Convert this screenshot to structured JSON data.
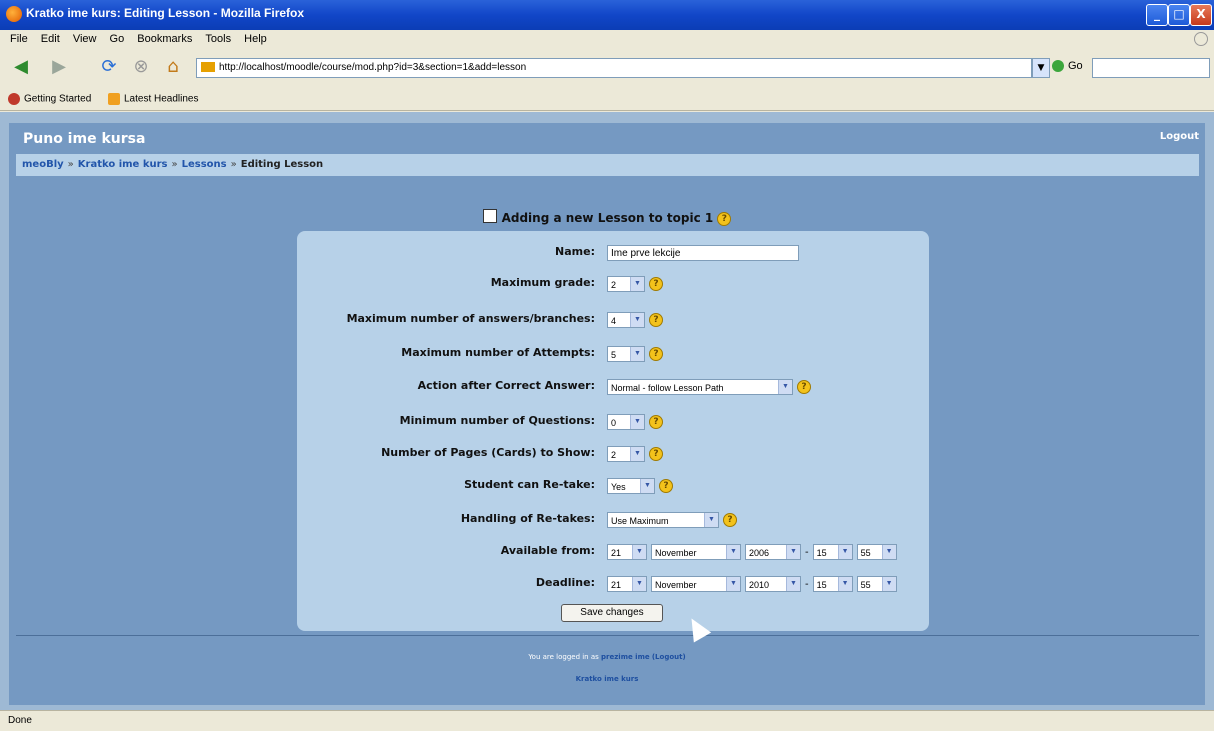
{
  "window": {
    "title": "Kratko ime kurs: Editing Lesson - Mozilla Firefox",
    "controls": {
      "minimize": "_",
      "maximize": "□",
      "close": "X"
    }
  },
  "menu": [
    "File",
    "Edit",
    "View",
    "Go",
    "Bookmarks",
    "Tools",
    "Help"
  ],
  "nav": {
    "url": "http://localhost/moodle/course/mod.php?id=3&section=1&add=lesson",
    "go_label": "Go"
  },
  "bookmarks": [
    {
      "label": "Getting Started",
      "color": "#c0392b"
    },
    {
      "label": "Latest Headlines",
      "color": "#f0a020"
    }
  ],
  "page": {
    "site_title": "Puno ime kursa",
    "logout": "Logout",
    "breadcrumb": [
      "meoBly",
      "Kratko ime kurs",
      "Lessons",
      "Editing Lesson"
    ],
    "breadcrumb_sep": "»",
    "heading": "Adding a new Lesson to topic 1",
    "help_glyph": "?"
  },
  "form": {
    "name": {
      "label": "Name:",
      "value": "Ime prve lekcije"
    },
    "max_grade": {
      "label": "Maximum grade:",
      "value": "2"
    },
    "max_answers": {
      "label": "Maximum number of answers/branches:",
      "value": "4"
    },
    "max_attempts": {
      "label": "Maximum number of Attempts:",
      "value": "5"
    },
    "action_after_correct": {
      "label": "Action after Correct Answer:",
      "value": "Normal - follow Lesson Path"
    },
    "min_questions": {
      "label": "Minimum number of Questions:",
      "value": "0"
    },
    "num_pages": {
      "label": "Number of Pages (Cards) to Show:",
      "value": "2"
    },
    "retake": {
      "label": "Student can Re-take:",
      "value": "Yes"
    },
    "handling_retakes": {
      "label": "Handling of Re-takes:",
      "value": "Use Maximum"
    },
    "available_from": {
      "label": "Available from:",
      "day": "21",
      "month": "November",
      "year": "2006",
      "hour": "15",
      "minute": "55"
    },
    "deadline": {
      "label": "Deadline:",
      "day": "21",
      "month": "November",
      "year": "2010",
      "hour": "15",
      "minute": "55"
    },
    "date_sep": "-",
    "save_label": "Save changes"
  },
  "footer": {
    "logged_in_text": "You are logged in as",
    "user": "prezime ime",
    "logout_link": "(Logout)",
    "course_link": "Kratko ime kurs"
  },
  "status": "Done"
}
